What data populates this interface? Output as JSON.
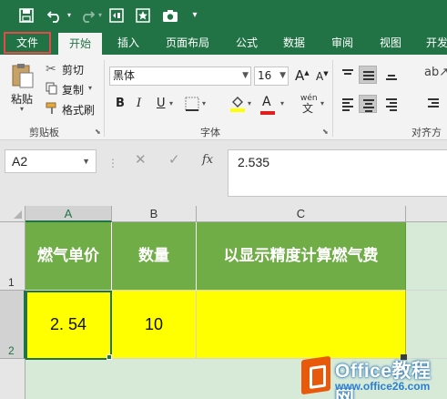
{
  "quick_access": {
    "icons": [
      "save-icon",
      "undo-icon",
      "redo-icon",
      "screenshot-icon",
      "star-icon",
      "camera-icon",
      "customize-dropdown-icon"
    ]
  },
  "tabs": [
    "文件",
    "开始",
    "插入",
    "页面布局",
    "公式",
    "数据",
    "审阅",
    "视图",
    "开发"
  ],
  "ribbon": {
    "clipboard": {
      "paste": "粘贴",
      "cut": "剪切",
      "copy": "复制",
      "format_painter": "格式刷",
      "label": "剪贴板"
    },
    "font": {
      "name": "黑体",
      "size": "16",
      "grow": "A",
      "shrink": "A",
      "bold": "B",
      "italic": "I",
      "underline": "U",
      "color_a": "A",
      "wen": "wén",
      "label": "字体"
    },
    "alignment": {
      "label": "对齐方"
    },
    "colors": {
      "fill": "#ffff00",
      "font_color": "#e02020"
    }
  },
  "formula_bar": {
    "name_box": "A2",
    "cancel": "✕",
    "enter": "✓",
    "fx": "fx",
    "content": "2.535"
  },
  "sheet": {
    "columns": [
      "A",
      "B",
      "C"
    ],
    "rows": [
      "1",
      "2"
    ],
    "header_row": [
      "燃气单价",
      "数量",
      "以显示精度计算燃气费"
    ],
    "data_row": [
      "2. 54",
      "10",
      ""
    ],
    "header_color": "#70ad47",
    "data_color": "#ffff00",
    "accent": "#217346"
  },
  "watermark": {
    "title": "Office教程网",
    "url": "www.office26.com"
  }
}
